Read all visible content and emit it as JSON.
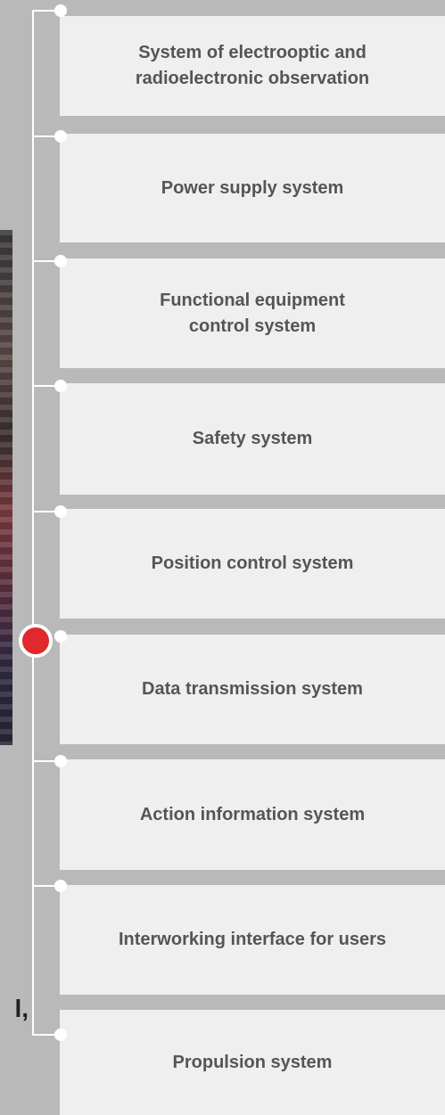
{
  "systems": [
    {
      "label": "System of electrooptic and radioelectronic observation",
      "active": false
    },
    {
      "label": "Power supply system",
      "active": false
    },
    {
      "label": "Functional equipment control system",
      "active": false
    },
    {
      "label": "Safety system",
      "active": false
    },
    {
      "label": "Position control system",
      "active": false
    },
    {
      "label": "Data transmission system",
      "active": true
    },
    {
      "label": "Action information system",
      "active": false
    },
    {
      "label": "Interworking interface for users",
      "active": false
    },
    {
      "label": "Propulsion system",
      "active": false
    }
  ],
  "bottom_left_text": "l,"
}
